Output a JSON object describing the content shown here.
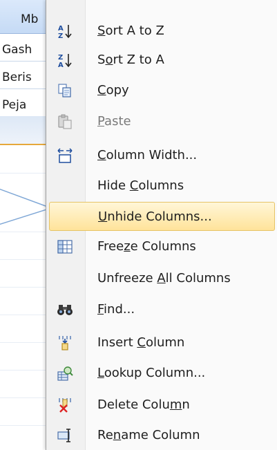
{
  "background_table": {
    "header_label": "Mb",
    "rows": [
      "Gash",
      "Beris",
      "Peja"
    ]
  },
  "context_menu": {
    "items": [
      {
        "prefix": "",
        "accel": "S",
        "suffix": "ort A to Z",
        "icon": "sort-a-to-z-icon"
      },
      {
        "prefix": "S",
        "accel": "o",
        "suffix": "rt Z to A",
        "icon": "sort-z-to-a-icon"
      },
      {
        "prefix": "",
        "accel": "C",
        "suffix": "opy",
        "icon": "copy-icon"
      },
      {
        "prefix": "",
        "accel": "P",
        "suffix": "aste",
        "icon": "paste-icon",
        "disabled": true
      },
      {
        "prefix": "",
        "accel": "C",
        "suffix": "olumn Width...",
        "icon": "column-width-icon"
      },
      {
        "prefix": "Hide ",
        "accel": "C",
        "suffix": "olumns"
      },
      {
        "prefix": "",
        "accel": "U",
        "suffix": "nhide Columns...",
        "highlighted": true
      },
      {
        "prefix": "Free",
        "accel": "z",
        "suffix": "e Columns",
        "icon": "freeze-columns-icon"
      },
      {
        "prefix": "Unfreeze ",
        "accel": "A",
        "suffix": "ll Columns"
      },
      {
        "prefix": "",
        "accel": "F",
        "suffix": "ind...",
        "icon": "binoculars-icon"
      },
      {
        "prefix": "Insert ",
        "accel": "C",
        "suffix": "olumn",
        "icon": "insert-column-icon"
      },
      {
        "prefix": "",
        "accel": "L",
        "suffix": "ookup Column...",
        "icon": "lookup-column-icon"
      },
      {
        "prefix": "Delete Colu",
        "accel": "m",
        "suffix": "n",
        "icon": "delete-column-icon"
      },
      {
        "prefix": "Re",
        "accel": "n",
        "suffix": "ame Column",
        "icon": "rename-column-icon"
      }
    ]
  },
  "colors": {
    "highlight": "#ffe39a",
    "header": "#c5daf5",
    "callout": "#9dc3e6"
  }
}
